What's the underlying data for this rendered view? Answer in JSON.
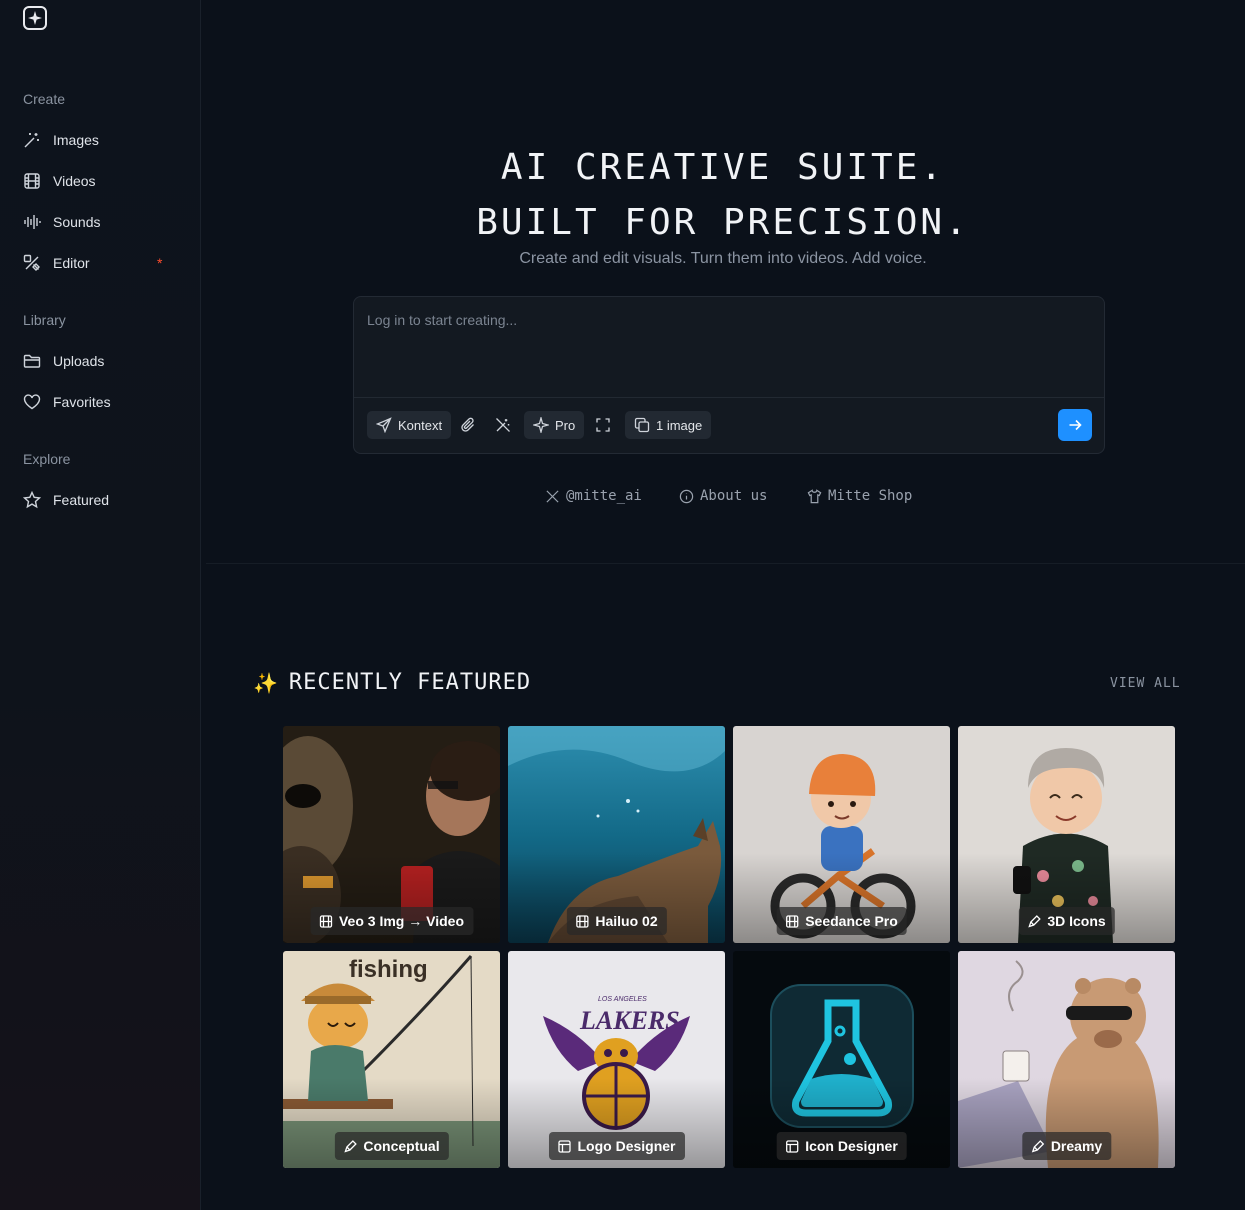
{
  "sidebar": {
    "sections": {
      "create": "Create",
      "library": "Library",
      "explore": "Explore"
    },
    "items": {
      "images": "Images",
      "videos": "Videos",
      "sounds": "Sounds",
      "editor": "Editor",
      "editor_badge": "*",
      "uploads": "Uploads",
      "favorites": "Favorites",
      "featured": "Featured"
    }
  },
  "hero": {
    "title_line1": "AI CREATIVE SUITE.",
    "title_line2": "BUILT FOR PRECISION.",
    "subtitle": "Create and edit visuals. Turn them into videos. Add voice."
  },
  "prompt": {
    "placeholder": "Log in to start creating...",
    "model_label": "Kontext",
    "pro_label": "Pro",
    "count_label": "1 image"
  },
  "links": {
    "x": "@mitte_ai",
    "about": "About us",
    "shop": "Mitte Shop"
  },
  "featured": {
    "title": "RECENTLY FEATURED",
    "emoji": "✨",
    "view_all": "VIEW ALL",
    "cards": [
      {
        "label": "Veo 3 Img → Video",
        "icon": "film-icon"
      },
      {
        "label": "Hailuo 02",
        "icon": "film-icon"
      },
      {
        "label": "Seedance Pro",
        "icon": "film-icon"
      },
      {
        "label": "3D Icons",
        "icon": "brush-icon"
      },
      {
        "label": "Conceptual",
        "icon": "brush-icon"
      },
      {
        "label": "Logo Designer",
        "icon": "layout-icon"
      },
      {
        "label": "Icon Designer",
        "icon": "layout-icon"
      },
      {
        "label": "Dreamy",
        "icon": "brush-icon"
      }
    ],
    "card_art_text": {
      "fishing": "fishing",
      "lakers_small": "LOS ANGELES",
      "lakers": "LAKERS"
    }
  },
  "colors": {
    "accent": "#1e90ff",
    "badge": "#ff4d2e",
    "background": "#0b111a"
  }
}
